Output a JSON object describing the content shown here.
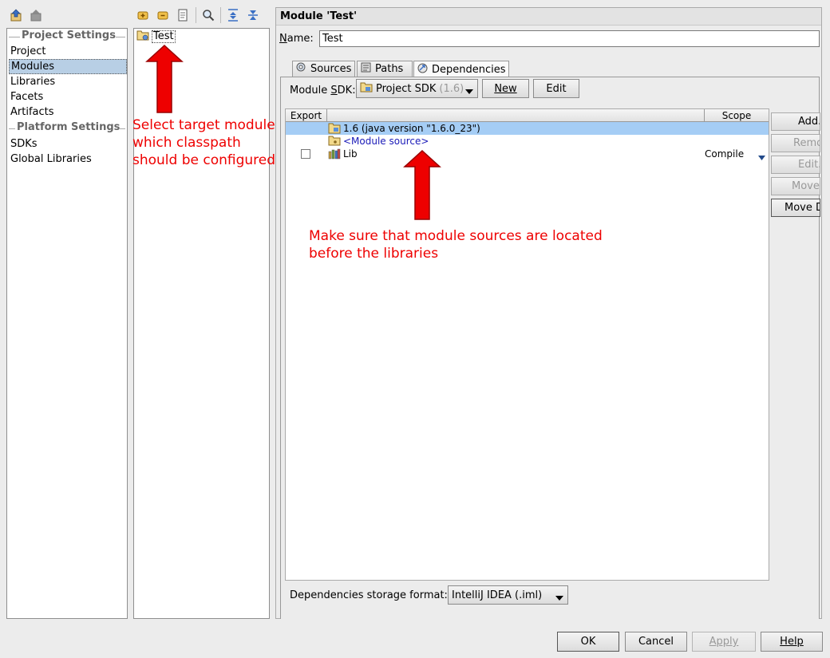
{
  "toolbar_left": {
    "icons": [
      "back-arrow-icon",
      "forward-arrow-icon"
    ]
  },
  "toolbar_mid": {
    "icons": [
      "add-module-icon",
      "remove-module-icon",
      "copy-module-icon",
      "find-icon",
      "expand-all-icon",
      "collapse-all-icon"
    ]
  },
  "sidebar": {
    "project_settings_header": "Project Settings",
    "platform_settings_header": "Platform Settings",
    "items": [
      "Project",
      "Modules",
      "Libraries",
      "Facets",
      "Artifacts"
    ],
    "platform_items": [
      "SDKs",
      "Global Libraries"
    ],
    "selected": "Modules"
  },
  "module_tree": {
    "items": [
      {
        "label": "Test"
      }
    ]
  },
  "module_panel": {
    "title": "Module 'Test'",
    "name_label": "Name:",
    "name_value": "Test",
    "tabs": [
      "Sources",
      "Paths",
      "Dependencies"
    ],
    "active_tab": "Dependencies",
    "sdk_label": "Module SDK:",
    "sdk_value": "Project SDK",
    "sdk_version": "(1.6)",
    "new_button": "New",
    "edit_button": "Edit",
    "table": {
      "headers": [
        "Export",
        "",
        "Scope"
      ],
      "rows": [
        {
          "label": "1.6 (java version \"1.6.0_23\")",
          "scope": "",
          "checkbox": false,
          "selected": true
        },
        {
          "label": "<Module source>",
          "scope": "",
          "checkbox": false,
          "selected": false
        },
        {
          "label": "Lib",
          "scope": "Compile",
          "checkbox": true,
          "checked": false,
          "selected": false
        }
      ]
    },
    "side_buttons": [
      "Add...",
      "Remove",
      "Edit...",
      "Move Up",
      "Move Down"
    ],
    "storage_label": "Dependencies storage format:",
    "storage_value": "IntelliJ IDEA (.iml)"
  },
  "annotations": {
    "select_module": [
      "Select target module",
      "which classpath",
      "should be configured"
    ],
    "module_sources": [
      "Make sure that module sources are located",
      "before the libraries"
    ]
  },
  "footer": {
    "ok": "OK",
    "cancel": "Cancel",
    "apply": "Apply",
    "help": "Help"
  },
  "colors": {
    "selection": "#b8cfe5",
    "row_selected": "#a5cdf5",
    "annotation": "#ee0000",
    "arrow": "#ee0000"
  }
}
